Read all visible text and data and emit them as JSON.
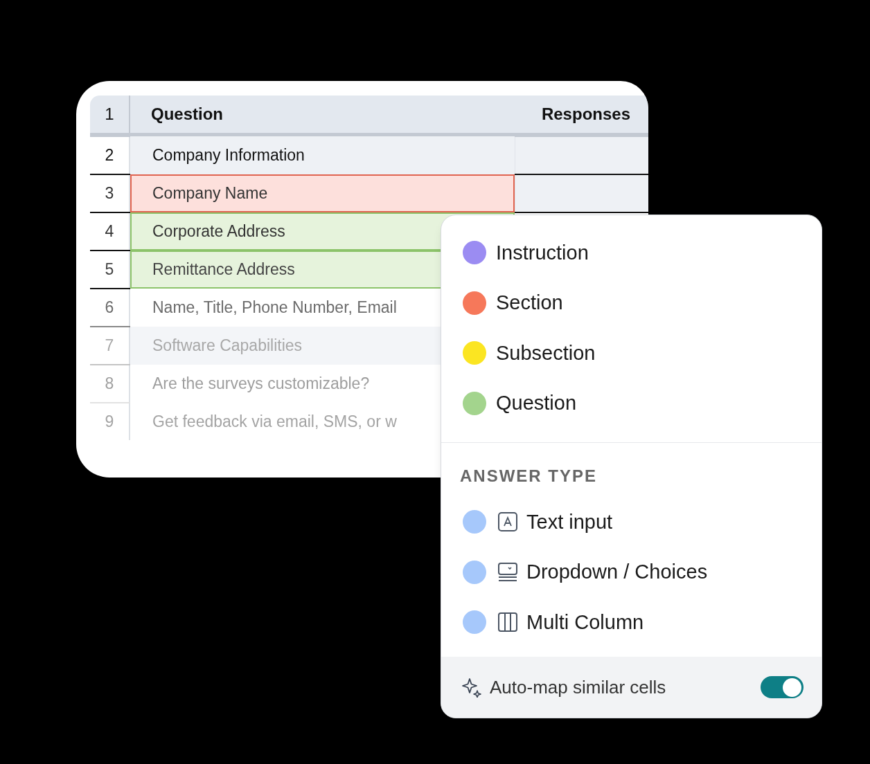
{
  "sheet": {
    "header": {
      "number": "1",
      "question": "Question",
      "responses": "Responses"
    },
    "rows": [
      {
        "number": "2",
        "text": "Company Information",
        "color": "#eef1f5"
      },
      {
        "number": "3",
        "text": "Company Name",
        "color": "#fde0dc"
      },
      {
        "number": "4",
        "text": "Corporate Address",
        "color": "#e6f3dc"
      },
      {
        "number": "5",
        "text": "Remittance Address",
        "color": "#e6f3dc"
      },
      {
        "number": "6",
        "text": "Name, Title, Phone Number, Email",
        "color": "#ffffff"
      },
      {
        "number": "7",
        "text": "Software Capabilities",
        "color": "#f3f5f8"
      },
      {
        "number": "8",
        "text": "Are the surveys customizable?",
        "color": "#ffffff"
      },
      {
        "number": "9",
        "text": "Get feedback via email, SMS, or w",
        "color": "#ffffff"
      }
    ]
  },
  "menu": {
    "categories": [
      {
        "label": "Instruction",
        "color": "#9b8cf2"
      },
      {
        "label": "Section",
        "color": "#f6785a"
      },
      {
        "label": "Subsection",
        "color": "#fbe522"
      },
      {
        "label": "Question",
        "color": "#a3d48d"
      }
    ],
    "answer_type": {
      "heading": "ANSWER TYPE",
      "items": [
        {
          "label": "Text input",
          "kind": "text",
          "color": "#a6c8fb"
        },
        {
          "label": "Dropdown / Choices",
          "kind": "dropdown",
          "color": "#a6c8fb"
        },
        {
          "label": "Multi Column",
          "kind": "columns",
          "color": "#a6c8fb"
        }
      ]
    },
    "footer": {
      "label": "Auto-map similar cells",
      "on": true
    }
  }
}
